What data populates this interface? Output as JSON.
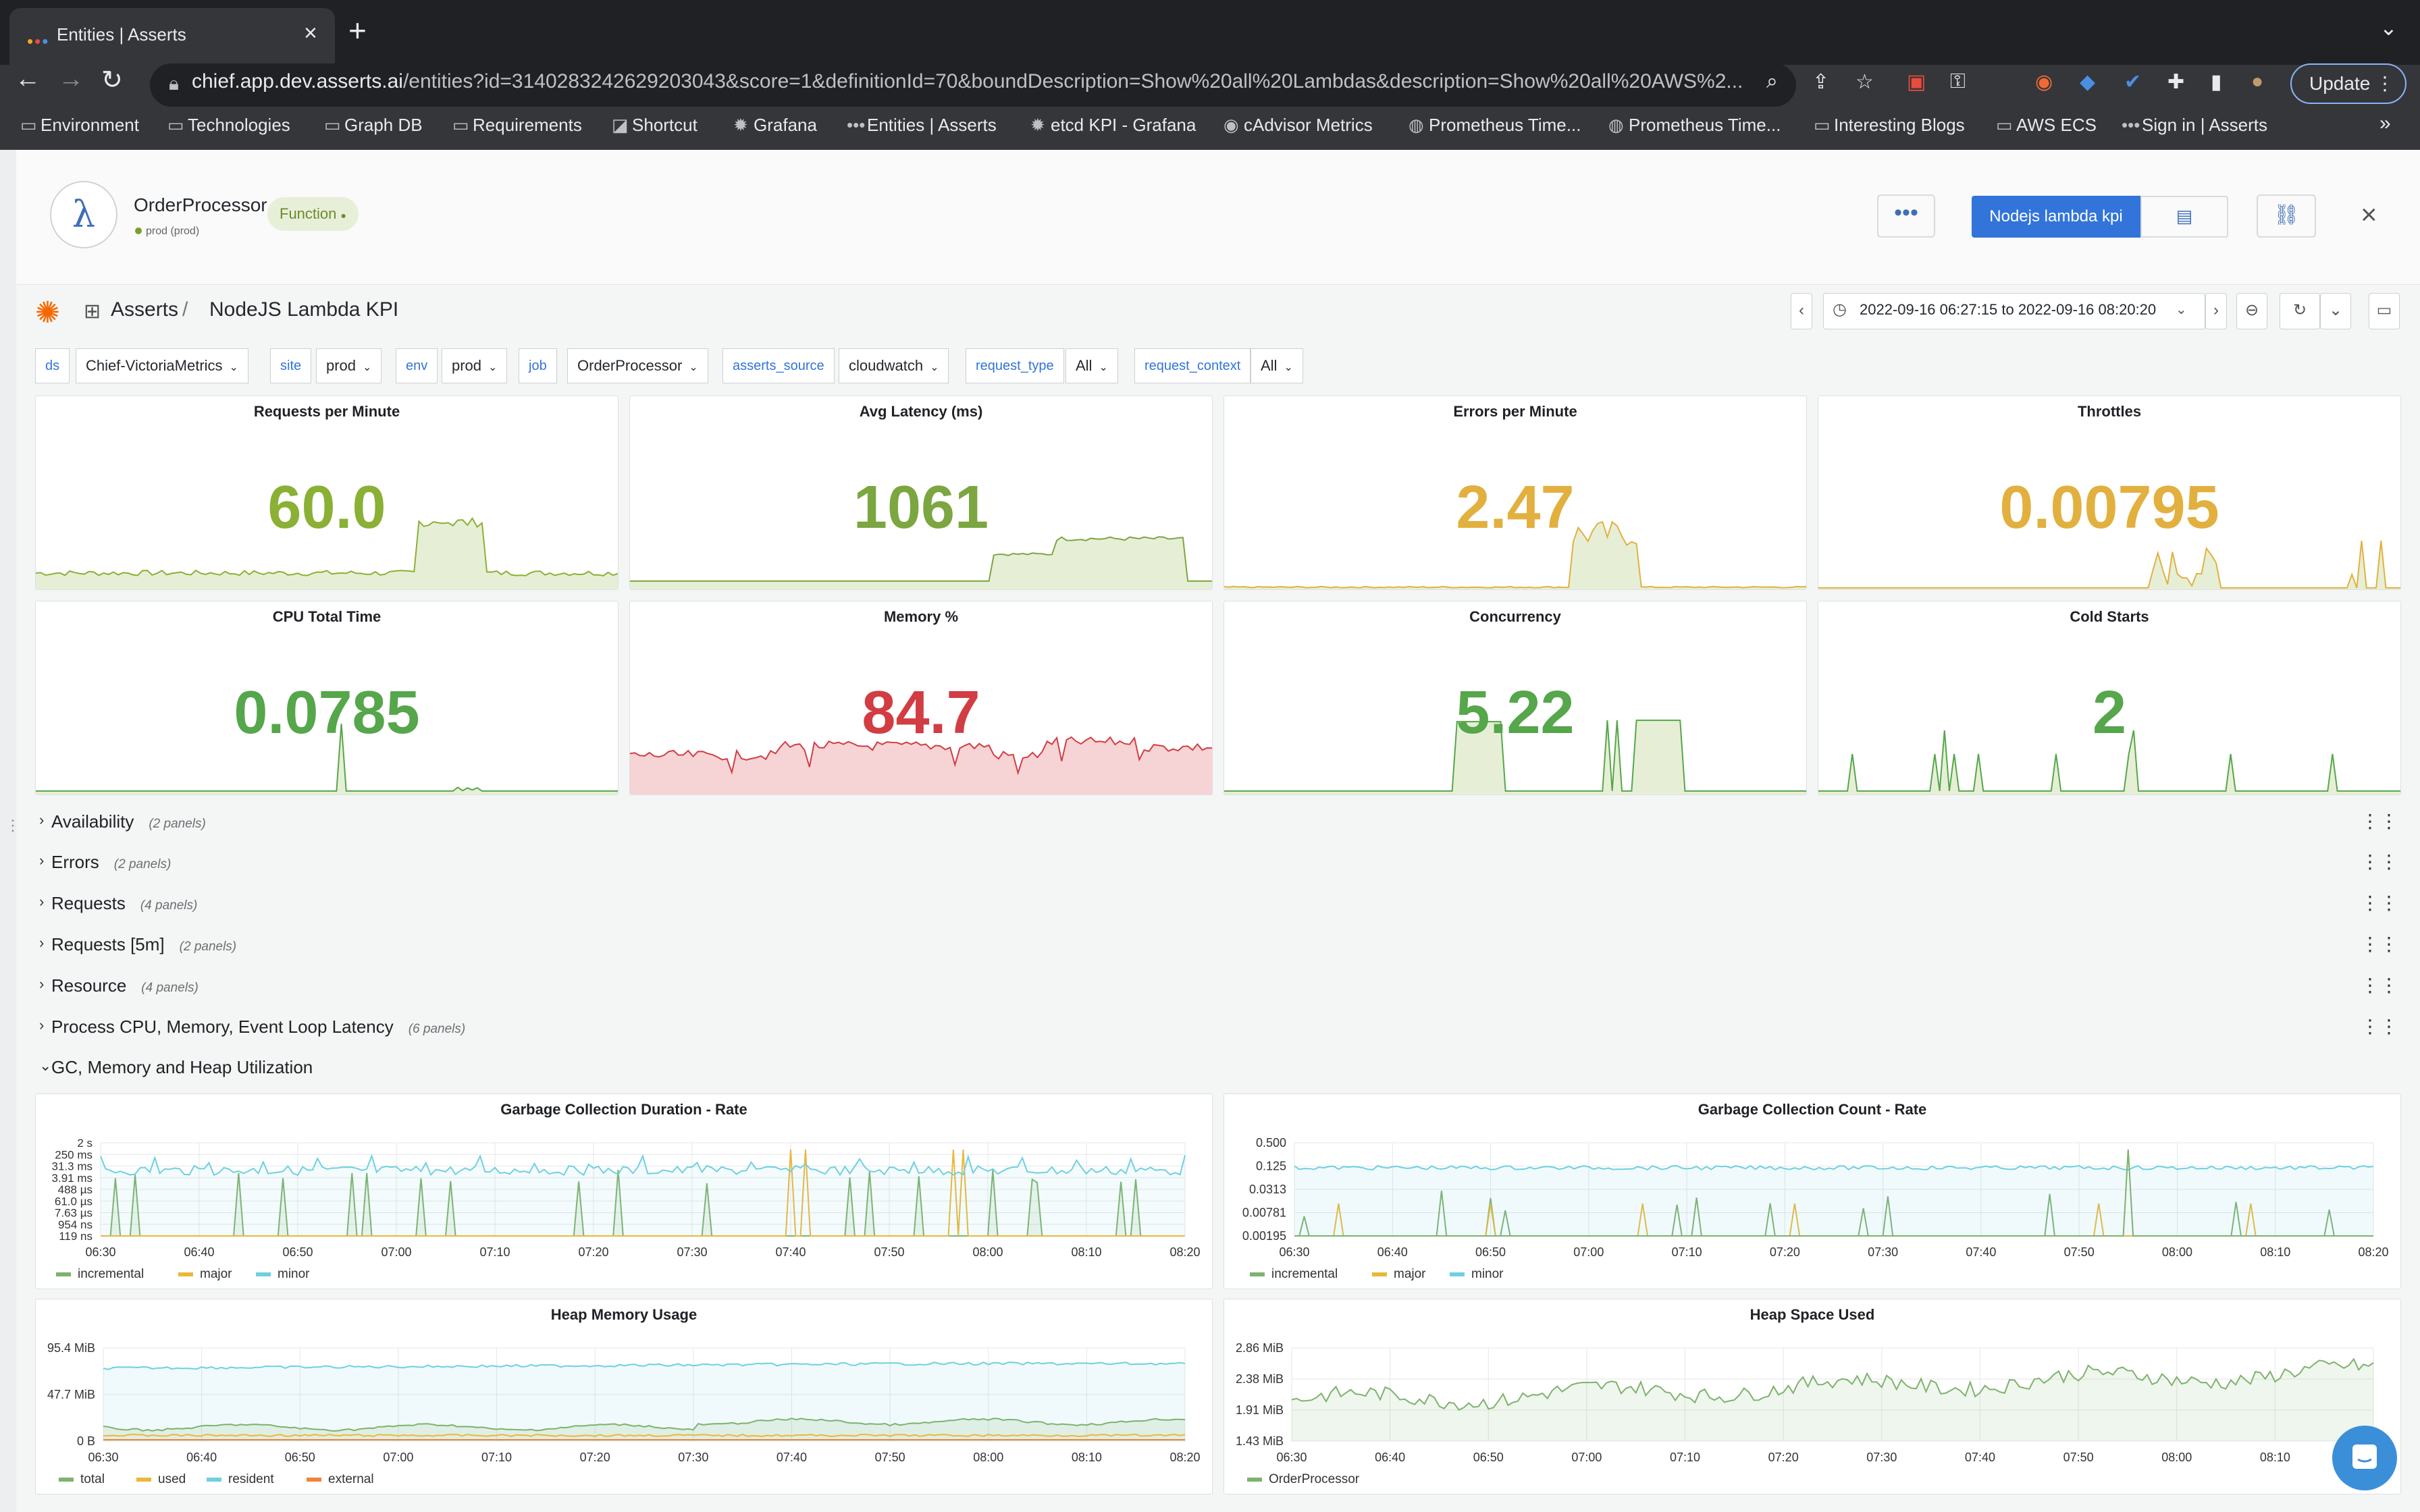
{
  "browser": {
    "tab_title": "Entities | Asserts",
    "url_host": "chief.app.dev.asserts.ai",
    "url_path": "/entities?id=3140283242629203043&score=1&definitionId=70&boundDescription=Show%20all%20Lambdas&description=Show%20all%20AWS%2...",
    "update_label": "Update",
    "bookmarks": [
      "Environment",
      "Technologies",
      "Graph DB",
      "Requirements",
      "Shortcut",
      "Grafana",
      "Entities | Asserts",
      "etcd KPI - Grafana",
      "cAdvisor Metrics",
      "Prometheus Time...",
      "Prometheus Time...",
      "Interesting Blogs",
      "AWS ECS",
      "Sign in | Asserts"
    ]
  },
  "entity": {
    "name": "OrderProcessor",
    "env": "prod (prod)",
    "type_badge": "Function",
    "kpi_button": "Nodejs lambda kpi"
  },
  "dashboard": {
    "folder": "Asserts",
    "title": "NodeJS Lambda KPI",
    "time_range": "2022-09-16 06:27:15 to 2022-09-16 08:20:20"
  },
  "variables": [
    {
      "name": "ds",
      "value": "Chief-VictoriaMetrics"
    },
    {
      "name": "site",
      "value": "prod"
    },
    {
      "name": "env",
      "value": "prod"
    },
    {
      "name": "job",
      "value": "OrderProcessor"
    },
    {
      "name": "asserts_source",
      "value": "cloudwatch"
    },
    {
      "name": "request_type",
      "value": "All"
    },
    {
      "name": "request_context",
      "value": "All"
    }
  ],
  "stats": [
    {
      "title": "Requests per Minute",
      "value": "60.0",
      "color": "#8ab035"
    },
    {
      "title": "Avg Latency (ms)",
      "value": "1061",
      "color": "#7ca640"
    },
    {
      "title": "Errors per Minute",
      "value": "2.47",
      "color": "#e2b03f"
    },
    {
      "title": "Throttles",
      "value": "0.00795",
      "color": "#e2b03f"
    },
    {
      "title": "CPU Total Time",
      "value": "0.0785",
      "color": "#56a64b"
    },
    {
      "title": "Memory %",
      "value": "84.7",
      "color": "#d23c43"
    },
    {
      "title": "Concurrency",
      "value": "5.22",
      "color": "#56a64b"
    },
    {
      "title": "Cold Starts",
      "value": "2",
      "color": "#56a64b"
    }
  ],
  "rows": [
    {
      "title": "Availability",
      "count": "(2 panels)",
      "chevron": "›"
    },
    {
      "title": "Errors",
      "count": "(2 panels)",
      "chevron": "›"
    },
    {
      "title": "Requests",
      "count": "(4 panels)",
      "chevron": "›"
    },
    {
      "title": "Requests [5m]",
      "count": "(2 panels)",
      "chevron": "›"
    },
    {
      "title": "Resource",
      "count": "(4 panels)",
      "chevron": "›"
    },
    {
      "title": "Process CPU, Memory, Event Loop Latency",
      "count": "(6 panels)",
      "chevron": "›"
    },
    {
      "title": "GC, Memory and Heap Utilization",
      "count": "",
      "chevron": "⌄"
    }
  ],
  "x_ticks": [
    "06:30",
    "06:40",
    "06:50",
    "07:00",
    "07:10",
    "07:20",
    "07:30",
    "07:40",
    "07:50",
    "08:00",
    "08:10",
    "08:20"
  ],
  "chart_data": [
    {
      "type": "line",
      "title": "Garbage Collection Duration - Rate",
      "y_ticks": [
        "2 s",
        "250 ms",
        "31.3 ms",
        "3.91 ms",
        "488 µs",
        "61.0 µs",
        "7.63 µs",
        "954 ns",
        "119 ns"
      ],
      "legend": [
        {
          "name": "incremental",
          "color": "#7eb26d"
        },
        {
          "name": "major",
          "color": "#eab839"
        },
        {
          "name": "minor",
          "color": "#6ed0e0"
        }
      ]
    },
    {
      "type": "line",
      "title": "Garbage Collection Count - Rate",
      "y_ticks": [
        "0.500",
        "0.125",
        "0.0313",
        "0.00781",
        "0.00195"
      ],
      "legend": [
        {
          "name": "incremental",
          "color": "#7eb26d"
        },
        {
          "name": "major",
          "color": "#eab839"
        },
        {
          "name": "minor",
          "color": "#6ed0e0"
        }
      ]
    },
    {
      "type": "area",
      "title": "Heap Memory Usage",
      "y_ticks": [
        "95.4 MiB",
        "47.7 MiB",
        "0 B"
      ],
      "legend": [
        {
          "name": "total",
          "color": "#7eb26d"
        },
        {
          "name": "used",
          "color": "#eab839"
        },
        {
          "name": "resident",
          "color": "#6ed0e0"
        },
        {
          "name": "external",
          "color": "#ef843c"
        }
      ]
    },
    {
      "type": "area",
      "title": "Heap Space Used",
      "y_ticks": [
        "2.86 MiB",
        "2.38 MiB",
        "1.91 MiB",
        "1.43 MiB"
      ],
      "legend": [
        {
          "name": "OrderProcessor",
          "color": "#7eb26d"
        }
      ]
    }
  ]
}
